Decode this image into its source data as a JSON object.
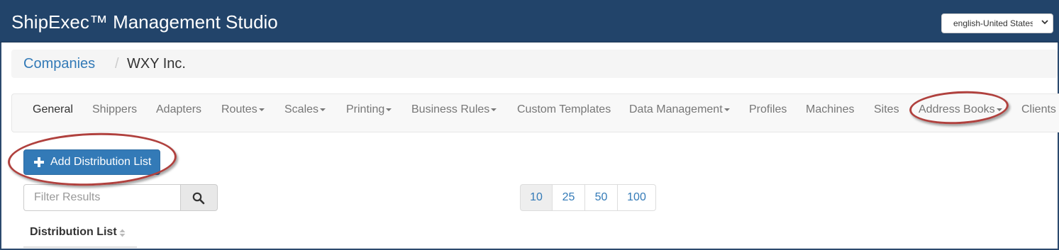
{
  "header": {
    "app_title": "ShipExec™ Management Studio",
    "language": "english-United States"
  },
  "breadcrumb": {
    "link": "Companies",
    "separator": "/",
    "current": "WXY Inc."
  },
  "nav": {
    "items": [
      {
        "label": "General",
        "dropdown": false,
        "active": true
      },
      {
        "label": "Shippers",
        "dropdown": false
      },
      {
        "label": "Adapters",
        "dropdown": false
      },
      {
        "label": "Routes",
        "dropdown": true
      },
      {
        "label": "Scales",
        "dropdown": true
      },
      {
        "label": "Printing",
        "dropdown": true
      },
      {
        "label": "Business Rules",
        "dropdown": true
      },
      {
        "label": "Custom Templates",
        "dropdown": false
      },
      {
        "label": "Data Management",
        "dropdown": true
      },
      {
        "label": "Profiles",
        "dropdown": false
      },
      {
        "label": "Machines",
        "dropdown": false
      },
      {
        "label": "Sites",
        "dropdown": false
      },
      {
        "label": "Address Books",
        "dropdown": true
      },
      {
        "label": "Clients",
        "dropdown": false
      }
    ]
  },
  "actions": {
    "add_label": "Add Distribution List"
  },
  "filter": {
    "placeholder": "Filter Results"
  },
  "page_size": {
    "options": [
      "10",
      "25",
      "50",
      "100"
    ],
    "selected": "10"
  },
  "table": {
    "column_header": "Distribution List"
  },
  "colors": {
    "header_bg": "#22446a",
    "primary": "#337ab7",
    "callout": "#b0413e"
  }
}
